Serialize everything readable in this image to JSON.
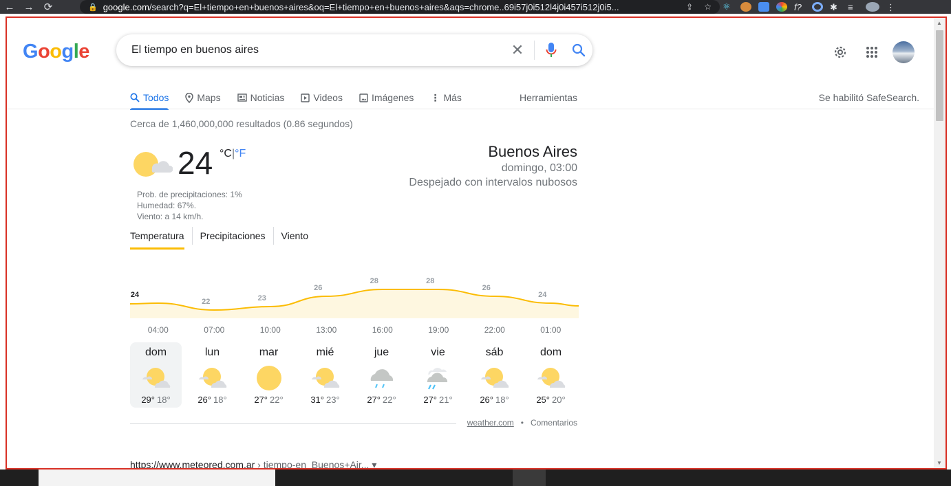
{
  "browser": {
    "url_domain": "google.com",
    "url_rest": "/search?q=El+tiempo+en+buenos+aires&oq=El+tiempo+en+buenos+aires&aqs=chrome..69i57j0i512l4j0i457i512j0i5..."
  },
  "header": {
    "logo": [
      "G",
      "o",
      "o",
      "g",
      "l",
      "e"
    ],
    "search_query": "El tiempo en buenos aires"
  },
  "tabs": [
    {
      "label": "Todos",
      "icon": "search-icon"
    },
    {
      "label": "Maps",
      "icon": "map-pin-icon"
    },
    {
      "label": "Noticias",
      "icon": "news-icon"
    },
    {
      "label": "Videos",
      "icon": "play-icon"
    },
    {
      "label": "Imágenes",
      "icon": "image-icon"
    },
    {
      "label": "Más",
      "icon": "more-vert-icon"
    }
  ],
  "tools_label": "Herramientas",
  "safesearch_label": "Se habilitó SafeSearch.",
  "stats": "Cerca de 1,460,000,000 resultados (0.86 segundos)",
  "weather": {
    "temp": "24",
    "unit_c": "°C",
    "unit_sep": "|",
    "unit_f": "°F",
    "precip": "Prob. de precipitaciones: 1%",
    "humidity": "Humedad: 67%.",
    "wind": "Viento: a 14 km/h.",
    "city": "Buenos Aires",
    "datetime": "domingo, 03:00",
    "description": "Despejado con intervalos nubosos",
    "tabs": [
      "Temperatura",
      "Precipitaciones",
      "Viento"
    ],
    "hours": [
      "04:00",
      "07:00",
      "10:00",
      "13:00",
      "16:00",
      "19:00",
      "22:00",
      "01:00"
    ],
    "hourly_temps": [
      24,
      22,
      23,
      26,
      28,
      28,
      26,
      24
    ],
    "days": [
      {
        "name": "dom",
        "max": "29°",
        "min": "18°",
        "icon": "partly-cloudy-icon"
      },
      {
        "name": "lun",
        "max": "26°",
        "min": "18°",
        "icon": "partly-cloudy-icon"
      },
      {
        "name": "mar",
        "max": "27°",
        "min": "22°",
        "icon": "sunny-icon"
      },
      {
        "name": "mié",
        "max": "31°",
        "min": "23°",
        "icon": "partly-cloudy-icon"
      },
      {
        "name": "jue",
        "max": "27°",
        "min": "22°",
        "icon": "rain-icon"
      },
      {
        "name": "vie",
        "max": "27°",
        "min": "21°",
        "icon": "showers-icon"
      },
      {
        "name": "sáb",
        "max": "26°",
        "min": "18°",
        "icon": "partly-cloudy-icon"
      },
      {
        "name": "dom",
        "max": "25°",
        "min": "20°",
        "icon": "partly-cloudy-icon"
      }
    ],
    "source": "weather.com",
    "bullet": "•",
    "feedback": "Comentarios"
  },
  "result": {
    "site": "https://www.meteored.com.ar",
    "path": " › tiempo-en_Buenos+Air... ▾"
  },
  "colors": {
    "accent": "#1a73e8",
    "chart_line": "#fbbc04",
    "chart_fill": "#fef7e0",
    "sun": "#fdd663"
  }
}
